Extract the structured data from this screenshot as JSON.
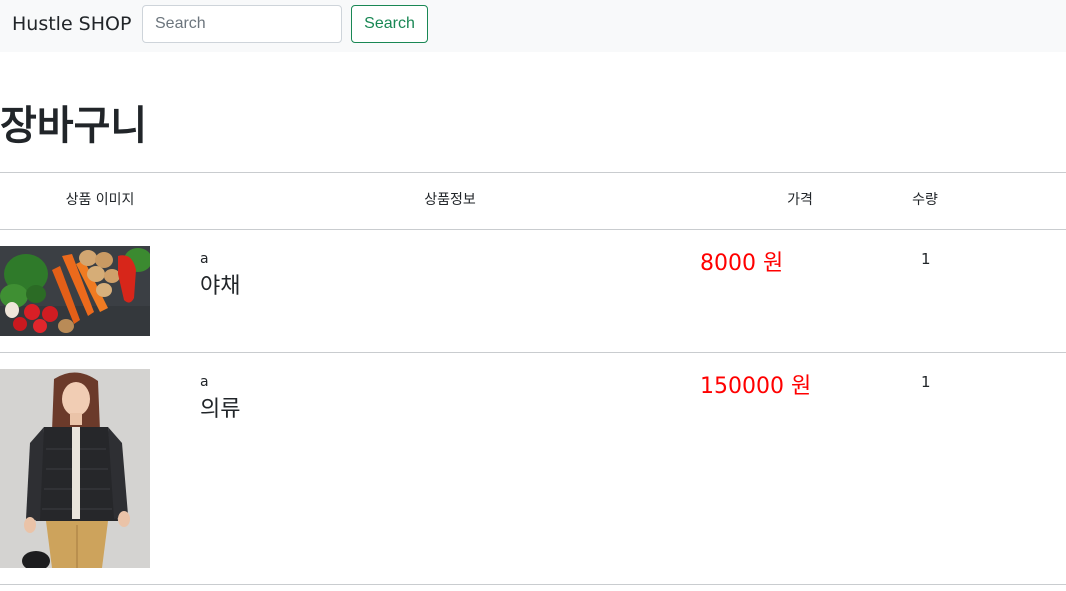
{
  "navbar": {
    "brand": "Hustle SHOP",
    "search_placeholder": "Search",
    "search_button": "Search"
  },
  "page_title": "장바구니",
  "table": {
    "headers": [
      "상품 이미지",
      "상품정보",
      "가격",
      "수량"
    ],
    "rows": [
      {
        "image": "vegetables-photo",
        "brand": "a",
        "name": "야채",
        "price": "8000 원",
        "quantity": "1"
      },
      {
        "image": "jacket-model-photo",
        "brand": "a",
        "name": "의류",
        "price": "150000 원",
        "quantity": "1"
      }
    ]
  },
  "colors": {
    "price": "#ff0000",
    "search_button": "#198754",
    "navbar_bg": "#f8f9fa"
  }
}
